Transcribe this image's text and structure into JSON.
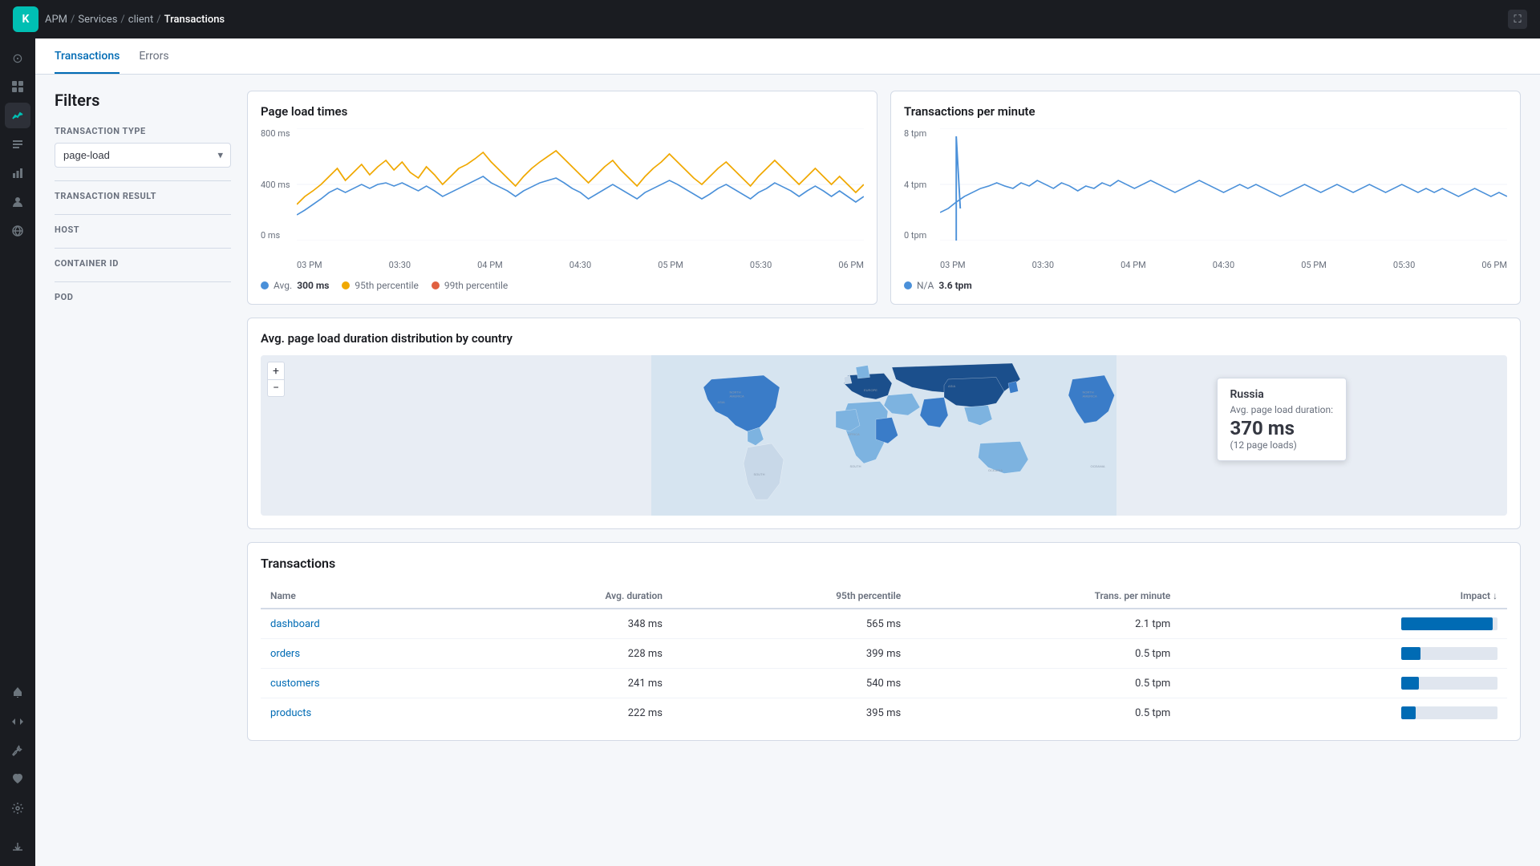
{
  "app": {
    "logo": "K",
    "logo_bg": "#00bfb3"
  },
  "breadcrumb": {
    "apm": "APM",
    "services": "Services",
    "client": "client",
    "current": "Transactions"
  },
  "tabs": [
    {
      "id": "transactions",
      "label": "Transactions",
      "active": true
    },
    {
      "id": "errors",
      "label": "Errors",
      "active": false
    }
  ],
  "filters": {
    "title": "Filters",
    "transaction_type_label": "TRANSACTION TYPE",
    "transaction_type_value": "page-load",
    "transaction_result_label": "TRANSACTION RESULT",
    "host_label": "HOST",
    "container_id_label": "CONTAINER ID",
    "pod_label": "POD"
  },
  "page_load_chart": {
    "title": "Page load times",
    "y_labels": [
      "800 ms",
      "400 ms",
      "0 ms"
    ],
    "x_labels": [
      "03 PM",
      "03:30",
      "04 PM",
      "04:30",
      "05 PM",
      "05:30",
      "06 PM"
    ],
    "legend": [
      {
        "label": "Avg.",
        "value": "300 ms",
        "color": "#4a90d9"
      },
      {
        "label": "95th percentile",
        "value": "",
        "color": "#f0a800"
      },
      {
        "label": "99th percentile",
        "value": "",
        "color": "#e06040"
      }
    ]
  },
  "tpm_chart": {
    "title": "Transactions per minute",
    "y_labels": [
      "8 tpm",
      "4 tpm",
      "0 tpm"
    ],
    "x_labels": [
      "03 PM",
      "03:30",
      "04 PM",
      "04:30",
      "05 PM",
      "05:30",
      "06 PM"
    ],
    "legend": [
      {
        "label": "N/A",
        "value": "3.6 tpm",
        "color": "#4a90d9"
      }
    ]
  },
  "map": {
    "title": "Avg. page load duration distribution by country",
    "tooltip": {
      "country": "Russia",
      "label": "Avg. page load duration:",
      "value": "370 ms",
      "sub": "(12 page loads)"
    },
    "regions": [
      "ASIA",
      "NORTH AMERICA",
      "EUROPE",
      "AFRICA",
      "OCEANIA",
      "SOUTH"
    ]
  },
  "transactions_table": {
    "title": "Transactions",
    "columns": [
      "Name",
      "Avg. duration",
      "95th percentile",
      "Trans. per minute",
      "Impact"
    ],
    "rows": [
      {
        "name": "dashboard",
        "avg_duration": "348 ms",
        "p95": "565 ms",
        "tpm": "2.1 tpm",
        "impact": 95
      },
      {
        "name": "orders",
        "avg_duration": "228 ms",
        "p95": "399 ms",
        "tpm": "0.5 tpm",
        "impact": 20
      },
      {
        "name": "customers",
        "avg_duration": "241 ms",
        "p95": "540 ms",
        "tpm": "0.5 tpm",
        "impact": 18
      },
      {
        "name": "products",
        "avg_duration": "222 ms",
        "p95": "395 ms",
        "tpm": "0.5 tpm",
        "impact": 15
      }
    ]
  },
  "sidebar_icons": [
    {
      "id": "home",
      "symbol": "⊙",
      "active": false
    },
    {
      "id": "dashboard",
      "symbol": "▦",
      "active": false
    },
    {
      "id": "apm",
      "symbol": "◈",
      "active": true
    },
    {
      "id": "logs",
      "symbol": "≡",
      "active": false
    },
    {
      "id": "metrics",
      "symbol": "📊",
      "active": false
    },
    {
      "id": "users",
      "symbol": "👤",
      "active": false
    },
    {
      "id": "globe",
      "symbol": "🌐",
      "active": false
    },
    {
      "id": "alerts",
      "symbol": "🔔",
      "active": false
    },
    {
      "id": "code",
      "symbol": "⟨/⟩",
      "active": false
    },
    {
      "id": "gear",
      "symbol": "⚙",
      "active": false
    },
    {
      "id": "wrench",
      "symbol": "🔧",
      "active": false
    },
    {
      "id": "heart",
      "symbol": "♥",
      "active": false
    }
  ]
}
